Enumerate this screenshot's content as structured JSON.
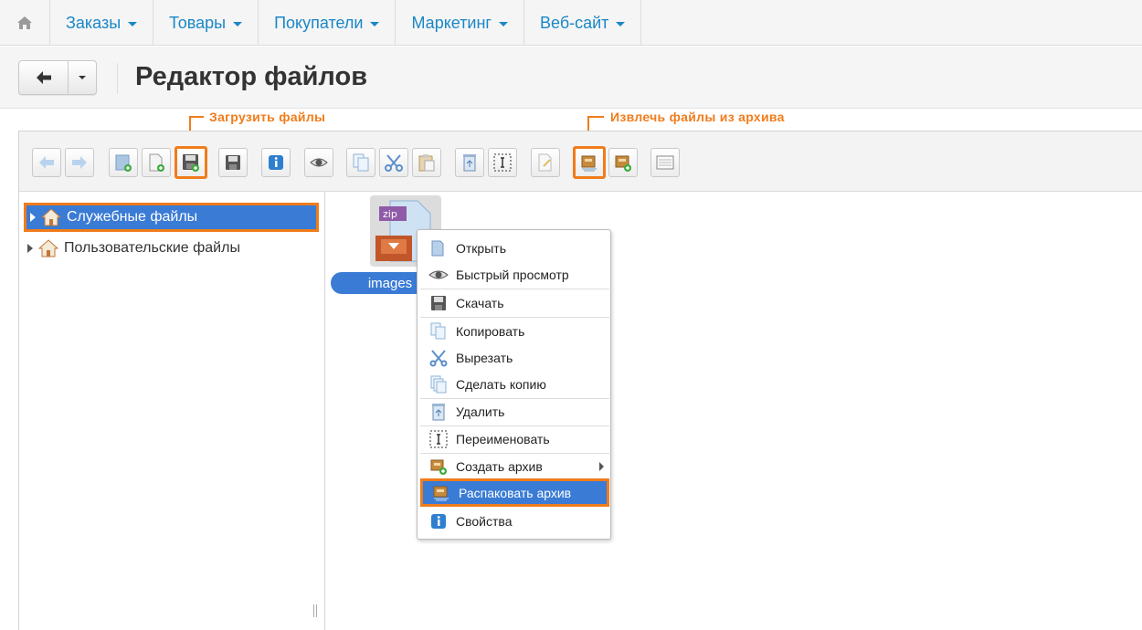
{
  "nav": {
    "items": [
      {
        "label": "Заказы"
      },
      {
        "label": "Товары"
      },
      {
        "label": "Покупатели"
      },
      {
        "label": "Маркетинг"
      },
      {
        "label": "Веб-сайт"
      }
    ]
  },
  "header": {
    "title": "Редактор файлов"
  },
  "callouts": {
    "upload": "Загрузить файлы",
    "extract": "Извлечь файлы из архива"
  },
  "tree": {
    "items": [
      {
        "label": "Служебные файлы",
        "selected": true
      },
      {
        "label": "Пользовательские файлы",
        "selected": false
      }
    ]
  },
  "files": [
    {
      "name": "images",
      "icon": "zip-archive-icon"
    }
  ],
  "context_menu": {
    "items": [
      {
        "label": "Открыть",
        "icon": "folder-open-icon"
      },
      {
        "label": "Быстрый просмотр",
        "icon": "eye-icon"
      },
      {
        "label": "Скачать",
        "icon": "floppy-disk-icon"
      },
      {
        "label": "Копировать",
        "icon": "copy-icon"
      },
      {
        "label": "Вырезать",
        "icon": "scissors-icon"
      },
      {
        "label": "Сделать копию",
        "icon": "duplicate-icon"
      },
      {
        "label": "Удалить",
        "icon": "trash-icon"
      },
      {
        "label": "Переименовать",
        "icon": "rename-icon"
      },
      {
        "label": "Создать архив",
        "icon": "archive-create-icon"
      },
      {
        "label": "Распаковать архив",
        "icon": "archive-extract-icon"
      },
      {
        "label": "Свойства",
        "icon": "info-icon"
      }
    ],
    "highlighted": "Распаковать архив"
  },
  "colors": {
    "accent": "#1a87c6",
    "highlight": "#f07c1b",
    "selection": "#3a7bd5"
  }
}
